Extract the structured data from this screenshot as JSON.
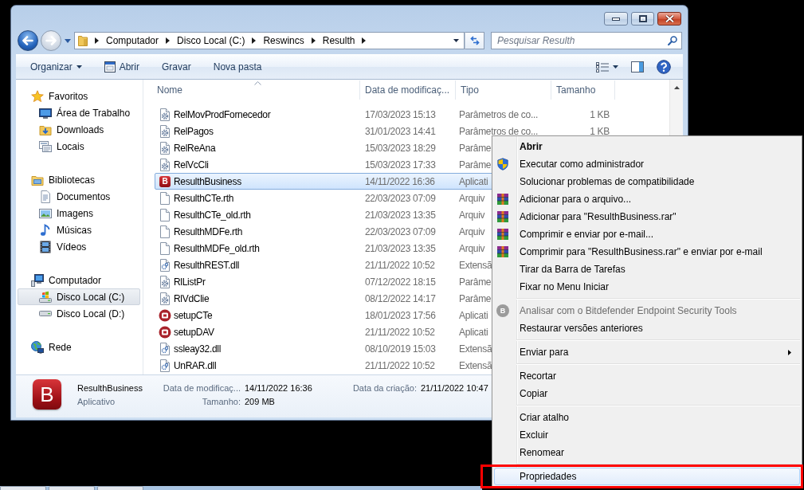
{
  "navigation": {
    "back": {
      "disabled": false
    },
    "forward": {
      "disabled": true
    }
  },
  "address_bar": {
    "crumbs": [
      "Computador",
      "Disco Local (C:)",
      "Reswincs",
      "Resulth"
    ]
  },
  "search": {
    "placeholder": "Pesquisar Resulth"
  },
  "toolbar": {
    "items": [
      {
        "label": "Organizar",
        "kind": "menu"
      },
      {
        "label": "Abrir",
        "kind": "icon"
      },
      {
        "label": "Gravar",
        "kind": "plain"
      },
      {
        "label": "Nova pasta",
        "kind": "plain"
      }
    ]
  },
  "sidebar": {
    "groups": [
      {
        "label": "Favoritos",
        "selected": false,
        "children": [
          {
            "label": "Área de Trabalho",
            "selected": false
          },
          {
            "label": "Downloads",
            "selected": false
          },
          {
            "label": "Locais",
            "selected": false
          }
        ]
      },
      {
        "label": "Bibliotecas",
        "selected": false,
        "children": [
          {
            "label": "Documentos",
            "selected": false
          },
          {
            "label": "Imagens",
            "selected": false
          },
          {
            "label": "Músicas",
            "selected": false
          },
          {
            "label": "Vídeos",
            "selected": false
          }
        ]
      },
      {
        "label": "Computador",
        "selected": false,
        "children": [
          {
            "label": "Disco Local (C:)",
            "selected": true
          },
          {
            "label": "Disco Local (D:)",
            "selected": false
          }
        ]
      },
      {
        "label": "Rede",
        "selected": false
      }
    ]
  },
  "file_list": {
    "columns": [
      {
        "label": "Nome",
        "sorted": true
      },
      {
        "label": "Data de modificaç...",
        "sorted": false
      },
      {
        "label": "Tipo",
        "sorted": false
      },
      {
        "label": "Tamanho",
        "sorted": false
      }
    ],
    "rows": [
      {
        "name": "RelMovProdFornecedor",
        "modified": "17/03/2023 15:13",
        "type": "Parâmetros de co...",
        "size": "1 KB",
        "kind": "config",
        "selected": false
      },
      {
        "name": "RelPagos",
        "modified": "31/01/2023 14:41",
        "type": "Parâmetros de co...",
        "size": "1 KB",
        "kind": "config",
        "selected": false
      },
      {
        "name": "RelReAna",
        "modified": "15/03/2023 18:29",
        "type": "Parâme",
        "kind": "config",
        "selected": false
      },
      {
        "name": "RelVcCli",
        "modified": "15/03/2023 17:33",
        "type": "Parâme",
        "kind": "config",
        "selected": false
      },
      {
        "name": "ResulthBusiness",
        "modified": "14/11/2022 16:36",
        "type": "Aplicati",
        "kind": "app",
        "icon_letter": "B",
        "selected": true
      },
      {
        "name": "ResulthCTe.rth",
        "modified": "22/03/2023 07:09",
        "type": "Arquiv",
        "kind": "blank",
        "selected": false
      },
      {
        "name": "ResulthCTe_old.rth",
        "modified": "21/03/2023 13:35",
        "type": "Arquiv",
        "kind": "blank",
        "selected": false
      },
      {
        "name": "ResulthMDFe.rth",
        "modified": "22/03/2023 07:09",
        "type": "Arquiv",
        "kind": "blank",
        "selected": false
      },
      {
        "name": "ResulthMDFe_old.rth",
        "modified": "21/03/2023 13:35",
        "type": "Arquiv",
        "kind": "blank",
        "selected": false
      },
      {
        "name": "ResulthREST.dll",
        "modified": "21/11/2022 10:52",
        "type": "Extensã",
        "kind": "library",
        "selected": false
      },
      {
        "name": "RlListPr",
        "modified": "07/12/2022 18:15",
        "type": "Parâme",
        "kind": "config",
        "selected": false
      },
      {
        "name": "RlVdClie",
        "modified": "08/12/2022 14:17",
        "type": "Parâme",
        "kind": "config",
        "selected": false
      },
      {
        "name": "setupCTe",
        "modified": "18/01/2023 17:56",
        "type": "Aplicati",
        "kind": "installer",
        "selected": false
      },
      {
        "name": "setupDAV",
        "modified": "21/11/2022 10:52",
        "type": "Aplicati",
        "kind": "installer",
        "selected": false
      },
      {
        "name": "ssleay32.dll",
        "modified": "08/10/2019 15:03",
        "type": "Extensã",
        "kind": "library",
        "selected": false
      },
      {
        "name": "UnRAR.dll",
        "modified": "21/11/2022 10:52",
        "type": "Extensã",
        "kind": "library",
        "selected": false
      }
    ]
  },
  "details_pane": {
    "icon_letter": "B",
    "name": "ResulthBusiness",
    "type": "Aplicativo",
    "fields": [
      {
        "label": "Data de modificaç...",
        "value": "14/11/2022 16:36"
      },
      {
        "label": "Tamanho:",
        "value": "209 MB"
      },
      {
        "label": "Data da criação:",
        "value": "21/11/2022 10:47"
      }
    ]
  },
  "context_menu": {
    "items": [
      {
        "kind": "command",
        "label": "Abrir",
        "default": true,
        "disabled": false,
        "selected": false,
        "outlined": false
      },
      {
        "kind": "elevated",
        "label": "Executar como administrador",
        "default": false,
        "disabled": false,
        "selected": false,
        "outlined": false
      },
      {
        "kind": "command",
        "label": "Solucionar problemas de compatibilidade",
        "default": false,
        "disabled": false,
        "selected": false,
        "outlined": false
      },
      {
        "kind": "archive",
        "label": "Adicionar para o arquivo...",
        "default": false,
        "disabled": false,
        "selected": false,
        "outlined": false
      },
      {
        "kind": "archive",
        "label": "Adicionar para \"ResulthBusiness.rar\"",
        "default": false,
        "disabled": false,
        "selected": false,
        "outlined": false
      },
      {
        "kind": "archive",
        "label": "Comprimir e enviar por e-mail...",
        "default": false,
        "disabled": false,
        "selected": false,
        "outlined": false
      },
      {
        "kind": "archive",
        "label": "Comprimir para \"ResulthBusiness.rar\" e enviar por e-mail",
        "default": false,
        "disabled": false,
        "selected": false,
        "outlined": false
      },
      {
        "kind": "command",
        "label": "Tirar da Barra de Tarefas",
        "default": false,
        "disabled": false,
        "selected": false,
        "outlined": false
      },
      {
        "kind": "command",
        "label": "Fixar no Menu Iniciar",
        "default": false,
        "disabled": false,
        "selected": false,
        "outlined": false
      },
      {
        "kind": "separator"
      },
      {
        "kind": "scan",
        "label": "Analisar com o Bitdefender Endpoint Security Tools",
        "icon_letter": "B",
        "default": false,
        "disabled": true,
        "selected": false,
        "outlined": false
      },
      {
        "kind": "command",
        "label": "Restaurar versões anteriores",
        "default": false,
        "disabled": false,
        "selected": false,
        "outlined": false
      },
      {
        "kind": "separator"
      },
      {
        "kind": "submenu",
        "label": "Enviar para",
        "default": false,
        "disabled": false,
        "selected": false,
        "outlined": false
      },
      {
        "kind": "separator"
      },
      {
        "kind": "command",
        "label": "Recortar",
        "default": false,
        "disabled": false,
        "selected": false,
        "outlined": false
      },
      {
        "kind": "command",
        "label": "Copiar",
        "default": false,
        "disabled": false,
        "selected": false,
        "outlined": false
      },
      {
        "kind": "separator"
      },
      {
        "kind": "command",
        "label": "Criar atalho",
        "default": false,
        "disabled": false,
        "selected": false,
        "outlined": false
      },
      {
        "kind": "command",
        "label": "Excluir",
        "default": false,
        "disabled": false,
        "selected": false,
        "outlined": false
      },
      {
        "kind": "command",
        "label": "Renomear",
        "default": false,
        "disabled": false,
        "selected": false,
        "outlined": false
      },
      {
        "kind": "separator"
      },
      {
        "kind": "command",
        "label": "Propriedades",
        "default": false,
        "disabled": false,
        "selected": true,
        "outlined": true
      }
    ]
  }
}
